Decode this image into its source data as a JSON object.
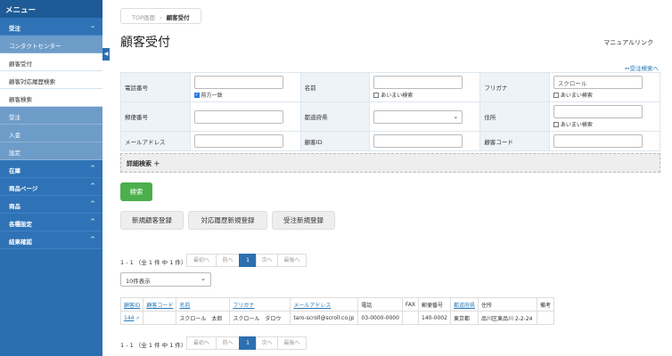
{
  "sidebar": {
    "title": "メニュー",
    "sections": [
      {
        "label": "受注",
        "expanded": true
      },
      {
        "label": "コンタクトセンター"
      },
      {
        "label": "顧客受付"
      },
      {
        "label": "顧客対応履歴検索"
      },
      {
        "label": "顧客検索"
      },
      {
        "label": "受注"
      },
      {
        "label": "入金"
      },
      {
        "label": "設定"
      },
      {
        "label": "在庫"
      },
      {
        "label": "商品ページ"
      },
      {
        "label": "商品"
      },
      {
        "label": "各種設定"
      },
      {
        "label": "結果確認"
      }
    ],
    "toggle_glyph": "◀"
  },
  "breadcrumb": {
    "home": "TOP画面",
    "sep": "›",
    "current": "顧客受付"
  },
  "page": {
    "title": "顧客受付",
    "manual_link": "マニュアルリンク",
    "order_list_link": "↔受注検索へ"
  },
  "form": {
    "phone_label": "電話番号",
    "phone_prefix_label": "前方一致",
    "name_label": "名前",
    "name_fuzzy_label": "あいまい検索",
    "kana_label": "フリガナ",
    "kana_value": "スクロール",
    "kana_fuzzy_label": "あいまい検索",
    "zip_label": "郵便番号",
    "pref_label": "都道府県",
    "address_label": "住所",
    "address_fuzzy_label": "あいまい検索",
    "email_label": "メールアドレス",
    "customer_id_label": "顧客ID",
    "customer_code_label": "顧客コード",
    "advanced_label": "詳細検索 ＋",
    "search_button": "検索"
  },
  "actions": {
    "new_customer": "新規顧客登録",
    "new_history": "対応履歴新規登録",
    "new_order": "受注新規登録"
  },
  "pager": {
    "info": "1 - 1 （全 1 件 中 1 件）",
    "first": "最初へ",
    "prev": "前へ",
    "page": "1",
    "next": "次へ",
    "last": "最後へ"
  },
  "per_page": "10件表示",
  "results": {
    "headers": [
      "顧客ID",
      "顧客コード",
      "名前",
      "フリガナ",
      "メールアドレス",
      "電話",
      "FAX",
      "郵便番号",
      "都道府県",
      "住所",
      "備考"
    ],
    "rows": [
      [
        "144",
        "",
        "スクロール　太郎",
        "スクロール　タロウ",
        "taro-scroll@scroll.co.jp",
        "03-0000-0000",
        "",
        "140-0002",
        "東京都",
        "品川区東品川 2-2-24",
        ""
      ]
    ]
  }
}
